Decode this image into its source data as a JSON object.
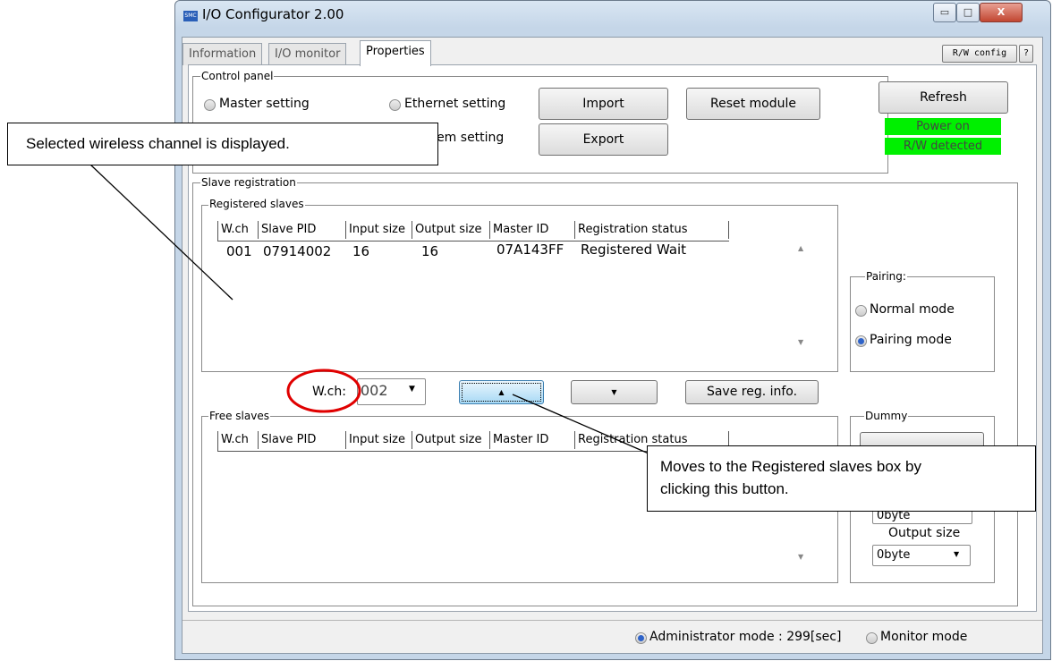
{
  "window": {
    "title": "I/O Configurator 2.00",
    "icon_text": "SMC",
    "min": "▭",
    "max": "□",
    "close": "X"
  },
  "tabs": [
    "Information",
    "I/O monitor",
    "Properties"
  ],
  "top_buttons": {
    "rw_config": "R/W config",
    "help": "?"
  },
  "control_panel": {
    "label": "Control panel",
    "master_setting": "Master setting",
    "ethernet_setting": "Ethernet setting",
    "system_setting": "ystem setting",
    "import": "Import",
    "export": "Export",
    "reset_module": "Reset module",
    "refresh": "Refresh",
    "power_on": "Power on",
    "rw_detected": "R/W detected"
  },
  "slave_registration": {
    "label": "Slave registration",
    "registered": {
      "label": "Registered slaves",
      "headers": [
        "W.ch",
        "Slave PID",
        "Input size",
        "Output size",
        "Master ID",
        "Registration status"
      ],
      "row": {
        "wch": "001",
        "pid": "07914002",
        "input": "16",
        "output": "16",
        "master": "07A143FF",
        "status": "Registered Wait"
      }
    },
    "free": {
      "label": "Free slaves",
      "headers": [
        "W.ch",
        "Slave PID",
        "Input size",
        "Output size",
        "Master ID",
        "Registration status"
      ]
    },
    "wch_label": "W.ch:",
    "wch_value": "002",
    "up_arrow": "▲",
    "down_arrow": "▼",
    "save_reg": "Save reg. info."
  },
  "pairing": {
    "label": "Pairing:",
    "normal": "Normal mode",
    "pairing_mode": "Pairing mode"
  },
  "dummy": {
    "label": "Dummy",
    "output_size_label": "Output size",
    "output_size_value": "0byte",
    "input_partial": "0byte"
  },
  "status_bar": {
    "admin": "Administrator mode : 299[sec]",
    "monitor": "Monitor mode"
  },
  "annotations": {
    "channel_note": "Selected wireless channel is displayed.",
    "move_note_1": "Moves to the Registered slaves box by",
    "move_note_2": "clicking this button."
  },
  "colors": {
    "status_green": "#00f000",
    "annotation_red": "#e00000",
    "radio_selected": "#2e63c9"
  },
  "scroll": {
    "up": "▲",
    "down": "▼"
  }
}
